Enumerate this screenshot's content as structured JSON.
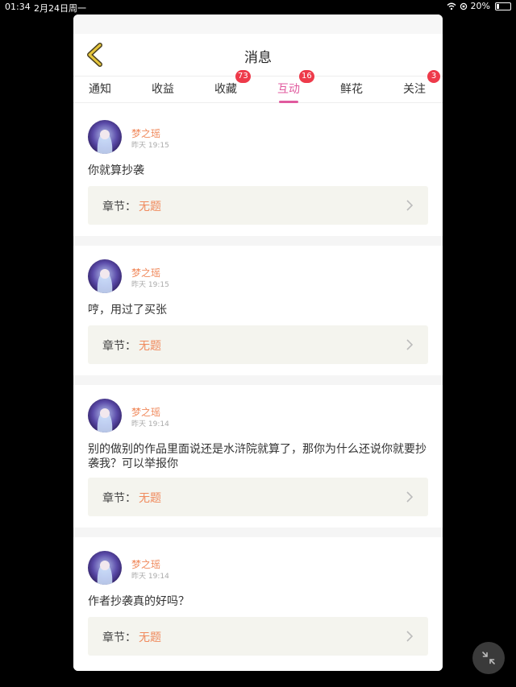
{
  "status_bar": {
    "time": "01:34",
    "date": "2月24日周一",
    "battery": "20%",
    "battery_level": 0.2
  },
  "header": {
    "title": "消息"
  },
  "tabs": [
    {
      "label": "通知",
      "badge": ""
    },
    {
      "label": "收益",
      "badge": ""
    },
    {
      "label": "收藏",
      "badge": "73"
    },
    {
      "label": "互动",
      "badge": "16",
      "active": true
    },
    {
      "label": "鲜花",
      "badge": ""
    },
    {
      "label": "关注",
      "badge": "3"
    }
  ],
  "messages": [
    {
      "user": "梦之瑶",
      "time": "昨天 19:15",
      "content": "你就算抄袭",
      "chapter_label": "章节：",
      "chapter": "无题"
    },
    {
      "user": "梦之瑶",
      "time": "昨天 19:15",
      "content": "哼，用过了买张",
      "chapter_label": "章节：",
      "chapter": "无题"
    },
    {
      "user": "梦之瑶",
      "time": "昨天 19:14",
      "content": "别的做别的作品里面说还是水浒院就算了，那你为什么还说你就要抄袭我？可以举报你",
      "chapter_label": "章节：",
      "chapter": "无题"
    },
    {
      "user": "梦之瑶",
      "time": "昨天 19:14",
      "content": "作者抄袭真的好吗？",
      "chapter_label": "章节：",
      "chapter": "无题"
    }
  ],
  "colors": {
    "accent": "#e05a9e",
    "username": "#f08a5d",
    "badge": "#ee3a4a",
    "chapter_bg": "#f4f4ee"
  },
  "icons": {
    "back": "back-arrow-icon",
    "chevron": "chevron-right-icon",
    "float": "minimize-icon"
  }
}
